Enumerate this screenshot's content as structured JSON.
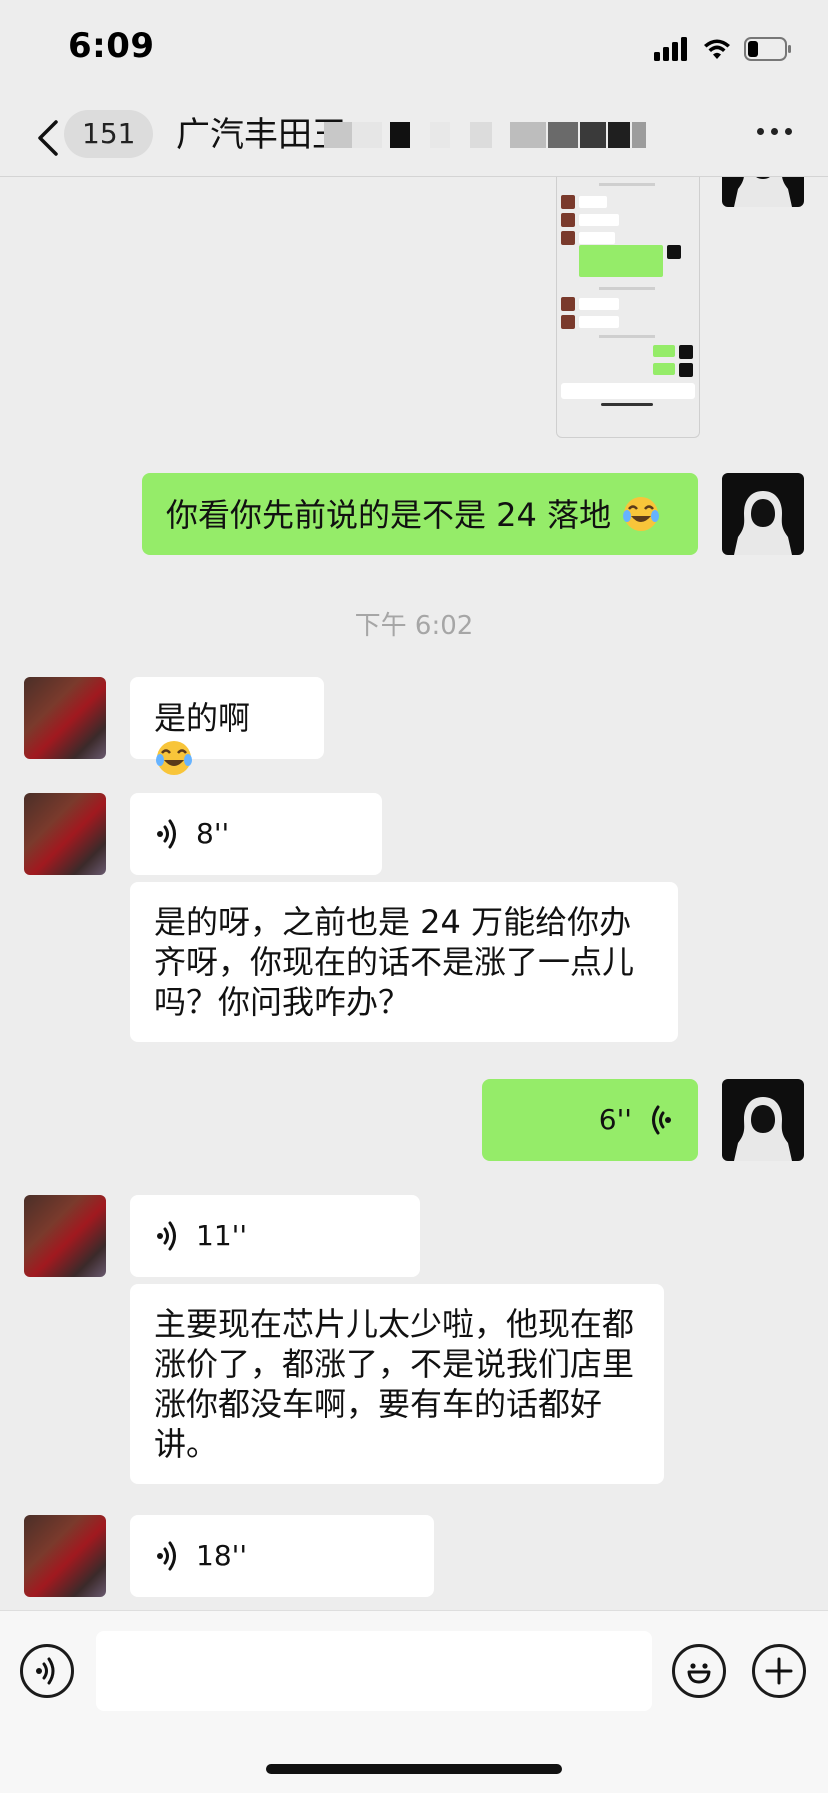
{
  "status_bar": {
    "time": "6:09"
  },
  "header": {
    "unread_count": "151",
    "title": "广汽丰田王"
  },
  "messages": {
    "m1_text": "你看你先前说的是不是 24 落地",
    "timestamp_1": "下午 6:02",
    "m2_text": "是的啊",
    "m3_voice": "8''",
    "m4_text": "是的呀，之前也是 24 万能给你办齐呀，你现在的话不是涨了一点儿吗？你问我咋办？",
    "m5_voice": "6''",
    "m6_voice": "11''",
    "m7_text": "主要现在芯片儿太少啦，他现在都涨价了，都涨了，不是说我们店里涨你都没车啊，要有车的话都好讲。",
    "m8_voice": "18''"
  },
  "input": {
    "value": "",
    "placeholder": ""
  },
  "icons": {
    "back": "chevron-left-icon",
    "more": "more-icon",
    "voice_toggle": "voice-icon",
    "emoji": "emoji-icon",
    "plus": "plus-icon",
    "emoji_in_text": "crying-laughing-emoji"
  },
  "colors": {
    "self_bubble": "#95ec69",
    "other_bubble": "#ffffff",
    "background": "#ededed"
  }
}
